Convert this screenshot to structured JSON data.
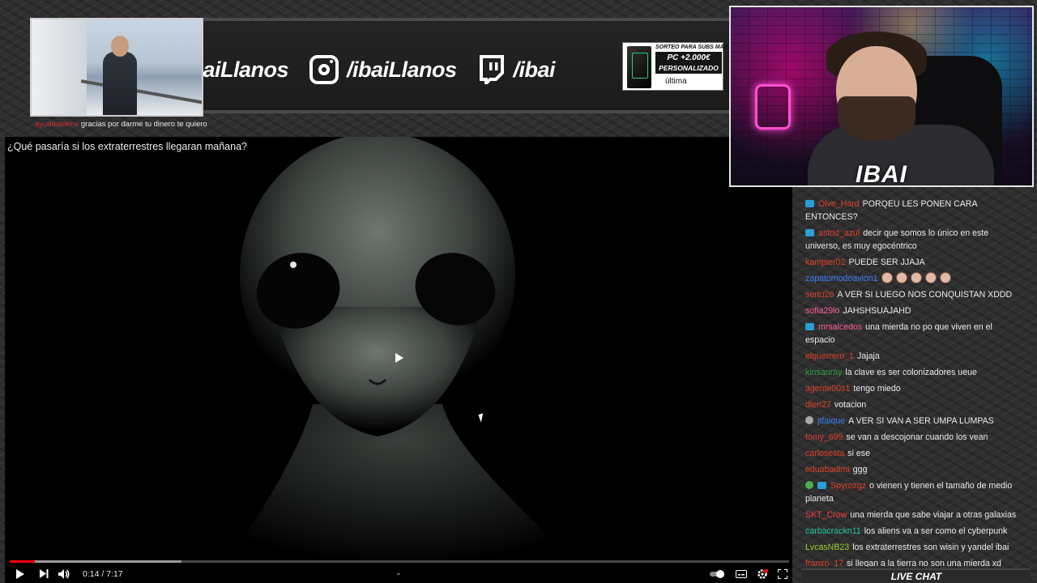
{
  "banner": {
    "socials": [
      {
        "handle": "/ibaiLlanos",
        "icon": "twitter-icon"
      },
      {
        "handle": "/ibaiLlanos",
        "icon": "instagram-icon"
      },
      {
        "handle": "/ibai",
        "icon": "twitch-icon"
      }
    ],
    "promo": {
      "top": "SORTEO PARA SUBS MARZO",
      "headline_1": "PC +2.000€",
      "headline_2": "PERSONALIZADO",
      "brand": "última"
    }
  },
  "caption": {
    "user": "ayudadelens",
    "text": "gracias por darme tu dinero te quiero"
  },
  "player": {
    "title": "¿Qué pasaría si los extraterrestres llegaran mañana?",
    "time": "0:14 / 7:17",
    "progress_played": 0.032,
    "progress_loaded": 0.22
  },
  "webcam": {
    "name": "IBAI"
  },
  "chat": {
    "footer": "LIVE CHAT",
    "colors": {
      "red": "#e0402a",
      "blue": "#3b82f6",
      "pink": "#ff5fa2",
      "green": "#2ea043",
      "lime": "#9acd32",
      "yellow": "#f2c94c",
      "teal": "#23c8a0",
      "orange": "#f05a28",
      "crimson": "#ff3b3b"
    },
    "messages": [
      {
        "user": "Olve_Hard",
        "text": "PORQEU LES PONEN CARA ENTONCES?",
        "color": "#e0402a",
        "badge": "sub"
      },
      {
        "user": "astrid_azul",
        "text": "decir que somos lo único en este universo, es muy egocéntrico",
        "color": "#e0402a",
        "badge": "sub"
      },
      {
        "user": "kampier02",
        "text": "PUEDE SER JJAJA",
        "color": "#e0402a"
      },
      {
        "user": "zapatomodoavion1",
        "text": "",
        "color": "#3b82f6",
        "emotes": 5
      },
      {
        "user": "sertu26",
        "text": "A VER SI LUEGO NOS CONQUISTAN XDDD",
        "color": "#e0402a"
      },
      {
        "user": "sofia29lo",
        "text": "JAHSHSUAJAHD",
        "color": "#ff5fa2"
      },
      {
        "user": "mrsalcedos",
        "text": "una mierda no po que viven en el espacio",
        "color": "#ff5fa2",
        "badge": "sub"
      },
      {
        "user": "elguerrero_1",
        "text": "Jajaja",
        "color": "#e0402a"
      },
      {
        "user": "kinsanray",
        "text": "la clave es ser colonizadores ueue",
        "color": "#2ea043"
      },
      {
        "user": "agente00s1",
        "text": "tengo miedo",
        "color": "#e0402a"
      },
      {
        "user": "dlen27",
        "text": "votacion",
        "color": "#e0402a"
      },
      {
        "user": "jtfaique",
        "text": "A VER SI VAN A SER UMPA LUMPAS",
        "color": "#3b82f6",
        "badge": "round"
      },
      {
        "user": "tomy_699",
        "text": "se van a descojonar cuando los vean",
        "color": "#e0402a"
      },
      {
        "user": "carlosesta",
        "text": "si ese",
        "color": "#e0402a"
      },
      {
        "user": "eduabadimi",
        "text": "ggg",
        "color": "#e0402a"
      },
      {
        "user": "Spyrozgz",
        "text": "o vienen y tienen el tamaño de medio planeta",
        "color": "#e0402a",
        "badge": "green+sub"
      },
      {
        "user": "SKT_Crow",
        "text": "una mierda que sabe viajar a otras galaxias",
        "color": "#ff3b3b"
      },
      {
        "user": "carbacrackn11",
        "text": "los aliens va a ser como el cyberpunk",
        "color": "#23c8a0"
      },
      {
        "user": "LvcasNB23",
        "text": "los extraterrestres son wisin y yandel ibai",
        "color": "#9acd32"
      },
      {
        "user": "franxo_17",
        "text": "si llegan a la tierra no son una mierda xd",
        "color": "#e0402a"
      }
    ]
  }
}
